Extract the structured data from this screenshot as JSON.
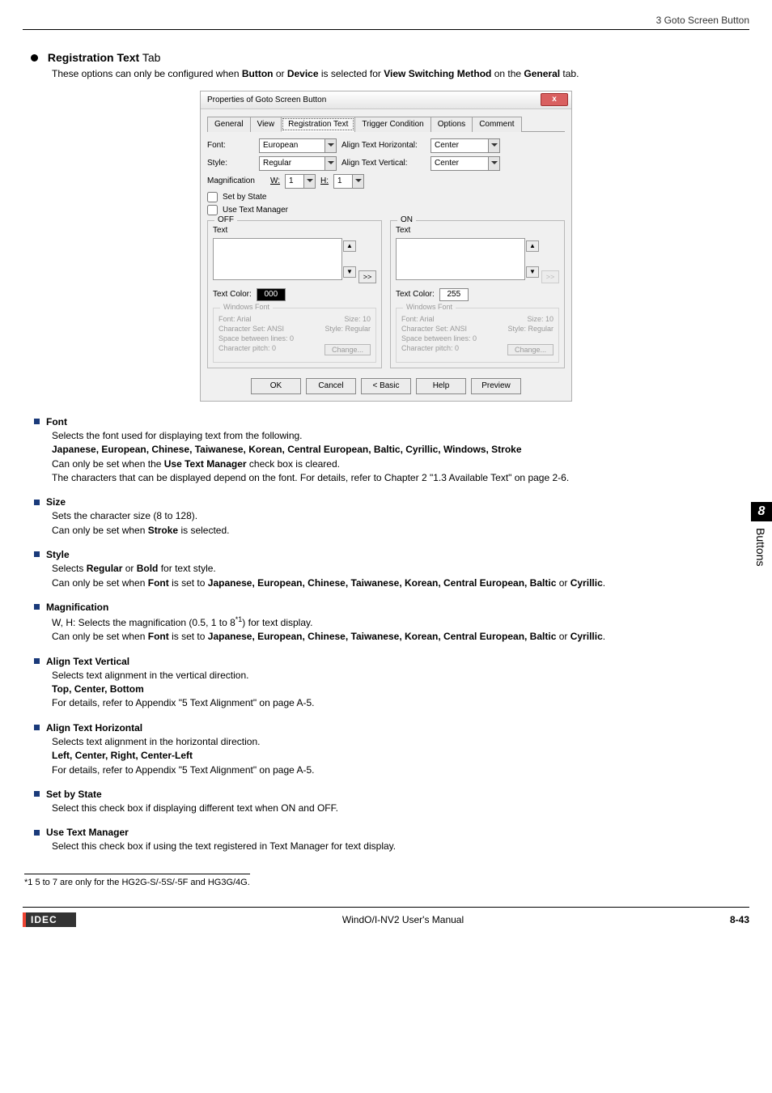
{
  "header": {
    "breadcrumb": "3 Goto Screen Button"
  },
  "section": {
    "bullet_title_bold": "Registration Text",
    "bullet_title_light": " Tab",
    "desc_pre": "These options can only be configured when ",
    "desc_b1": "Button",
    "desc_mid1": " or ",
    "desc_b2": "Device",
    "desc_mid2": " is selected for ",
    "desc_b3": "View Switching Method",
    "desc_mid3": " on the ",
    "desc_b4": "General",
    "desc_post": " tab."
  },
  "dialog": {
    "title": "Properties of Goto Screen Button",
    "close_glyph": "x",
    "tabs": [
      "General",
      "View",
      "Registration Text",
      "Trigger Condition",
      "Options",
      "Comment"
    ],
    "active_tab_index": 2,
    "font_label": "Font:",
    "font_value": "European",
    "style_label": "Style:",
    "style_value": "Regular",
    "alignH_label": "Align Text Horizontal:",
    "alignH_value": "Center",
    "alignV_label": "Align Text Vertical:",
    "alignV_value": "Center",
    "mag_label": "Magnification",
    "mag_W": "W:",
    "mag_W_val": "1",
    "mag_H": "H:",
    "mag_H_val": "1",
    "chk_state": "Set by State",
    "chk_tm": "Use Text Manager",
    "off_legend": "OFF",
    "on_legend": "ON",
    "text_label": "Text",
    "copy_btn": ">>",
    "textcolor_label": "Text Color:",
    "off_color_txt": "000",
    "on_color_txt": "255",
    "wfont_legend": "Windows Font",
    "wf_font": "Font:   Arial",
    "wf_size": "Size:   10",
    "wf_cs": "Character Set:   ANSI",
    "wf_style": "Style:   Regular",
    "wf_sbl": "Space between lines:   0",
    "wf_cp": "Character pitch:   0",
    "wf_change": "Change...",
    "btns": {
      "ok": "OK",
      "cancel": "Cancel",
      "basic": "< Basic",
      "help": "Help",
      "preview": "Preview"
    }
  },
  "items": {
    "font": {
      "title": "Font",
      "l1": "Selects the font used for displaying text from the following.",
      "l2": "Japanese, European, Chinese, Taiwanese, Korean, Central European, Baltic, Cyrillic, Windows, Stroke",
      "l3a": "Can only be set when the ",
      "l3b": "Use Text Manager",
      "l3c": " check box is cleared.",
      "l4": "The characters that can be displayed depend on the font. For details, refer to Chapter 2 \"1.3 Available Text\" on page 2-6."
    },
    "size": {
      "title": "Size",
      "l1": "Sets the character size (8 to 128).",
      "l2a": "Can only be set when ",
      "l2b": "Stroke",
      "l2c": " is selected."
    },
    "style": {
      "title": "Style",
      "l1a": "Selects ",
      "l1b": "Regular",
      "l1c": " or ",
      "l1d": "Bold",
      "l1e": " for text style.",
      "l2a": "Can only be set when ",
      "l2b": "Font",
      "l2c": " is set to ",
      "l2list": "Japanese, European, Chinese, Taiwanese, Korean, Central European, Baltic",
      "l2d": " or ",
      "l2e": "Cyrillic",
      "l2f": "."
    },
    "mag": {
      "title": "Magnification",
      "l1a": "W, H:    Selects the magnification (0.5, 1 to 8",
      "l1sup": "*1",
      "l1b": ") for text display.",
      "l2a": "Can only be set when ",
      "l2b": "Font",
      "l2c": " is set to ",
      "l2list": "Japanese, European, Chinese, Taiwanese, Korean, Central European, Baltic",
      "l2d": " or ",
      "l2e": "Cyrillic",
      "l2f": "."
    },
    "av": {
      "title": "Align Text Vertical",
      "l1": "Selects text alignment in the vertical direction.",
      "l2": "Top, Center, Bottom",
      "l3": "For details, refer to Appendix \"5 Text Alignment\" on page A-5."
    },
    "ah": {
      "title": "Align Text Horizontal",
      "l1": "Selects text alignment in the horizontal direction.",
      "l2": "Left, Center, Right, Center-Left",
      "l3": "For details, refer to Appendix \"5 Text Alignment\" on page A-5."
    },
    "sbs": {
      "title": "Set by State",
      "l1": "Select this check box if displaying different text when ON and OFF."
    },
    "utm": {
      "title": "Use Text Manager",
      "l1": "Select this check box if using the text registered in Text Manager for text display."
    }
  },
  "footnote": "*1  5 to 7 are only for the HG2G-S/-5S/-5F and HG3G/4G.",
  "footer": {
    "logo": "IDEC",
    "center": "WindO/I-NV2 User's Manual",
    "page": "8-43"
  },
  "sidetab": {
    "num": "8",
    "label": "Buttons"
  }
}
